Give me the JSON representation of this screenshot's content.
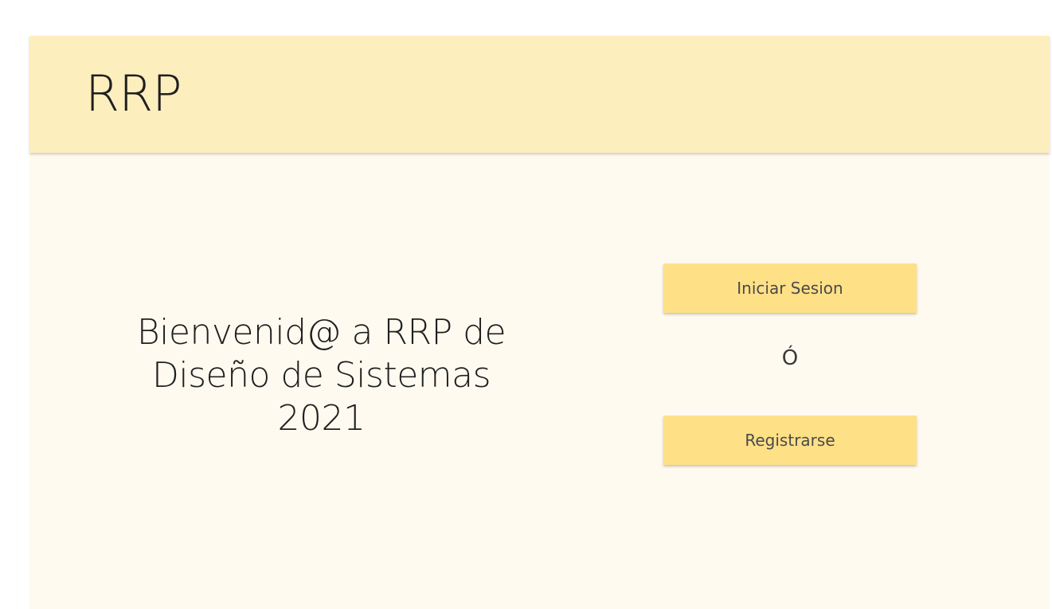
{
  "header": {
    "brand": "RRP"
  },
  "welcome": {
    "line1": "Bienvenid@ a RRP de",
    "line2": "Diseño de Sistemas",
    "line3": "2021"
  },
  "auth": {
    "login_label": "Iniciar Sesion",
    "or_label": "Ó",
    "register_label": "Registrarse"
  },
  "colors": {
    "header_bg": "#fdeebd",
    "page_bg": "#fffaf0",
    "button_bg": "#fee087"
  }
}
